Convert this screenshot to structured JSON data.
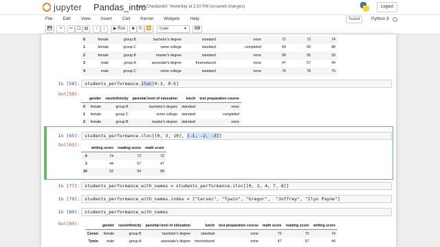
{
  "header": {
    "logo_text": "jupyter",
    "notebook_name": "Pandas_intro",
    "checkpoint": "Last Checkpoint: Yesterday at 2:10 PM",
    "unsaved": "(unsaved changes)",
    "logout_label": "Logout"
  },
  "menubar": {
    "items": [
      "File",
      "Edit",
      "View",
      "Insert",
      "Cell",
      "Kernel",
      "Widgets",
      "Help"
    ],
    "trusted_label": "Trusted",
    "kernel_name": "Python 3"
  },
  "toolbar": {
    "run_label": "Run",
    "cell_type": "Code",
    "buttons": [
      "save-icon",
      "plus-icon",
      "cut-icon",
      "copy-icon",
      "paste-icon",
      "up-arrow-icon",
      "down-arrow-icon",
      "run-icon",
      "stop-icon",
      "restart-icon",
      "fast-forward-icon",
      "keyboard-icon"
    ]
  },
  "cells": {
    "top_output": {
      "rows": [
        [
          "0",
          "female",
          "group B",
          "bachelor's degree",
          "standard",
          "none",
          "72",
          "72",
          "74"
        ],
        [
          "1",
          "female",
          "group C",
          "some college",
          "standard",
          "completed",
          "69",
          "90",
          "88"
        ],
        [
          "2",
          "female",
          "group B",
          "master's degree",
          "standard",
          "none",
          "90",
          "95",
          "93"
        ],
        [
          "3",
          "male",
          "group A",
          "associate's degree",
          "free/reduced",
          "none",
          "47",
          "57",
          "44"
        ],
        [
          "4",
          "male",
          "group C",
          "some college",
          "standard",
          "none",
          "76",
          "78",
          "75"
        ]
      ]
    },
    "c58": {
      "in_prompt": "In [58]:",
      "code_pre": "students_performance.",
      "code_hl": "iloc",
      "code_post": "[0:3, 0:5]",
      "out_prompt": "Out[58]:",
      "columns": [
        "",
        "gender",
        "race/ethnicity",
        "parental level of education",
        "lunch",
        "test preparation course"
      ],
      "rows": [
        [
          "0",
          "female",
          "group B",
          "bachelor's degree",
          "standard",
          "none"
        ],
        [
          "1",
          "female",
          "group C",
          "some college",
          "standard",
          "completed"
        ],
        [
          "2",
          "female",
          "group B",
          "master's degree",
          "standard",
          "none"
        ]
      ]
    },
    "c65": {
      "in_prompt": "In [65]:",
      "code_pre": "students_performance.iloc[[0, 3, 10], ",
      "code_hl": "[-1, -2, -3]",
      "code_post": "]",
      "out_prompt": "Out[65]:",
      "columns": [
        "",
        "writing score",
        "reading score",
        "math score"
      ],
      "rows": [
        [
          "0",
          "74",
          "72",
          "72"
        ],
        [
          "3",
          "44",
          "57",
          "47"
        ],
        [
          "10",
          "52",
          "54",
          "58"
        ]
      ]
    },
    "c77": {
      "in_prompt": "In [77]:",
      "code": "students_performance_with_names = students_performance.iloc[[0, 3, 4, 7, 8]]"
    },
    "c79": {
      "in_prompt": "In [79]:",
      "code": "students_performance_with_names.index = [\"Cersei\", \"Tywin\", \"Gregor\",  \"Joffrey\", \"Ilyn Payne\"]"
    },
    "c80": {
      "in_prompt": "In [80]:",
      "code": "students_performance_with_names",
      "out_prompt": "Out[80]:",
      "columns": [
        "",
        "gender",
        "race/ethnicity",
        "parental level of education",
        "lunch",
        "test preparation course",
        "math score",
        "reading score",
        "writing score"
      ],
      "rows": [
        [
          "Cersei",
          "female",
          "group B",
          "bachelor's degree",
          "standard",
          "none",
          "72",
          "72",
          "74"
        ],
        [
          "Tywin",
          "male",
          "group A",
          "associate's degree",
          "free/reduced",
          "none",
          "47",
          "57",
          "44"
        ]
      ]
    }
  }
}
